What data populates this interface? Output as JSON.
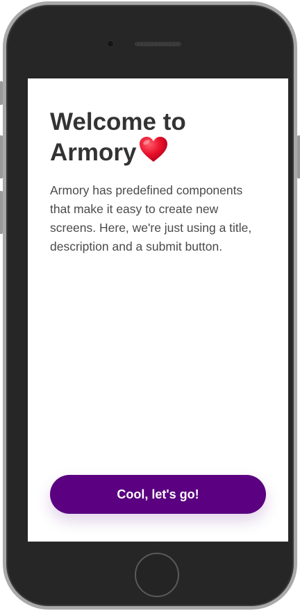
{
  "screen": {
    "title": "Welcome to Armory",
    "title_icon": "heart-icon",
    "description": "Armory has predefined components that make it easy to create new screens. Here, we're just using a title, description and a submit button.",
    "submit_label": "Cool, let's go!"
  },
  "colors": {
    "primary": "#5a0080",
    "title_text": "#333333",
    "body_text": "#4a4a4a",
    "heart": "#e8102a",
    "device_frame": "#262626"
  }
}
